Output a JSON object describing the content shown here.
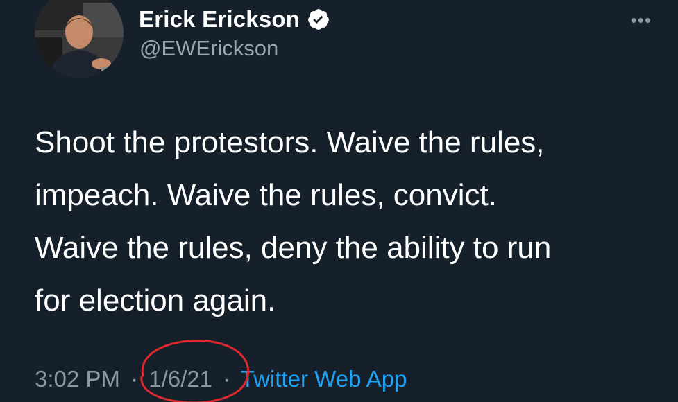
{
  "tweet": {
    "author": {
      "display_name": "Erick Erickson",
      "handle": "@EWErickson",
      "verified": true
    },
    "more_icon": "more-options-icon",
    "text": "Shoot the protestors.  Waive the rules,\nimpeach.  Waive the rules, convict.\nWaive the rules, deny the ability to run\nfor election again.",
    "time": "3:02 PM",
    "separator": "·",
    "date": "1/6/21",
    "source": "Twitter Web App"
  },
  "colors": {
    "background": "#15202b",
    "text": "#ffffff",
    "secondary": "#8899a6",
    "link": "#1da1f2",
    "annotation": "#e0292f"
  }
}
